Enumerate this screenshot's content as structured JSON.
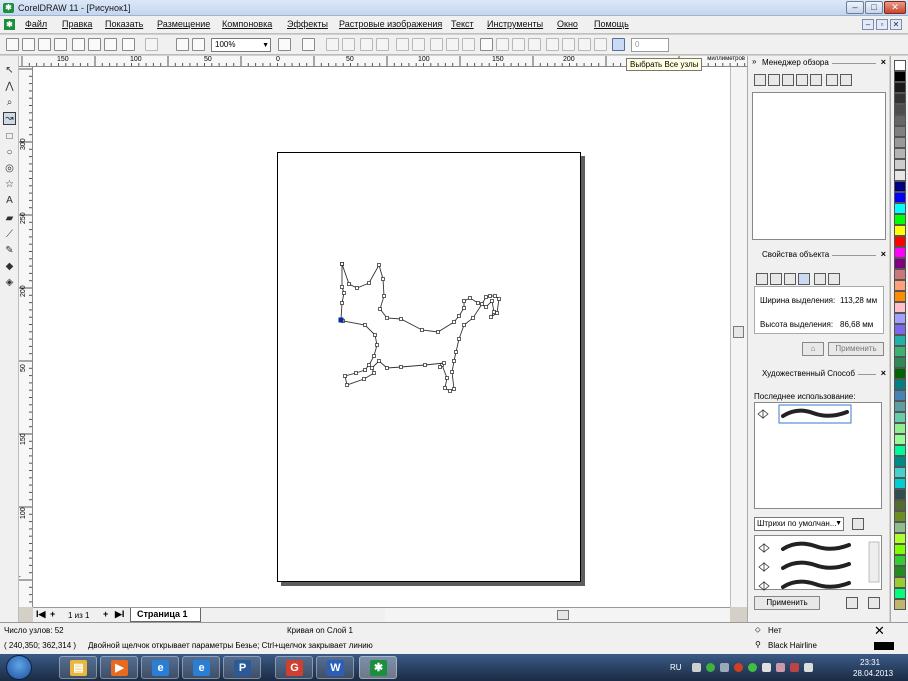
{
  "window": {
    "title": "CorelDRAW 11 - [Рисунок1]",
    "controls": {
      "minimize": "–",
      "maximize": "□",
      "close": "✕"
    }
  },
  "menu": {
    "items": [
      "Файл",
      "Правка",
      "Показать",
      "Размещение",
      "Компоновка",
      "Эффекты",
      "Растровые изображения",
      "Текст",
      "Инструменты",
      "Окно",
      "Помощь"
    ],
    "mdi": {
      "minimize": "–",
      "restore": "▫",
      "close": "✕"
    }
  },
  "toolbar": {
    "zoom_value": "100%",
    "nudge_value": "0",
    "tooltip": "Выбрать Все узлы"
  },
  "rulers": {
    "units": "миллиметров",
    "h_ticks": [
      "150",
      "100",
      "50",
      "0",
      "50",
      "100",
      "150",
      "200"
    ],
    "v_ticks": [
      "300",
      "250",
      "200",
      "150",
      "100",
      "50"
    ]
  },
  "page_nav": {
    "first": "I◀",
    "add_before": "+",
    "page_count": "1 из 1",
    "add_after": "+",
    "last": "▶I",
    "current_tab": "Страница 1"
  },
  "dockers": {
    "overview": {
      "title": "Менеджер обзора"
    },
    "properties": {
      "title": "Свойства объекта",
      "width_label": "Ширина выделения:",
      "width_value": "113,28 мм",
      "height_label": "Высота выделения:",
      "height_value": "86,68 мм",
      "apply_label": "Применить"
    },
    "artistic": {
      "title": "Художественный Способ",
      "last_used_label": "Последнее использование:",
      "preset_dropdown": "Штрихи по умолчан...",
      "apply_label": "Применить"
    }
  },
  "status": {
    "node_count": "Число узлов: 52",
    "object_info": "Кривая on Слой 1",
    "fill_label": "Нет",
    "outline_label": "Black  Hairline",
    "coords": "( 240,350; 362,314 )",
    "hint": "Двойной щелчок открывает параметры Безье; Ctrl+щелчок закрывает линию"
  },
  "taskbar": {
    "lang": "RU",
    "time": "23:31",
    "date": "28.04.2013"
  },
  "palette": [
    "#ffffff",
    "#000000",
    "#1a1a1a",
    "#333333",
    "#4d4d4d",
    "#666666",
    "#808080",
    "#999999",
    "#b3b3b3",
    "#cccccc",
    "#e6e6e6",
    "#000080",
    "#0000ff",
    "#00ffff",
    "#00ff00",
    "#ffff00",
    "#ff0000",
    "#ff00ff",
    "#800080",
    "#c87878",
    "#ffa07a",
    "#ff8c00",
    "#ffc0cb",
    "#a0a0ff",
    "#7b68ee",
    "#20b2aa",
    "#3cb371",
    "#2e8b57",
    "#006400",
    "#008080",
    "#4682b4",
    "#5f9ea0",
    "#66cdaa",
    "#90ee90",
    "#98fb98",
    "#00fa9a",
    "#008b8b",
    "#48d1cc",
    "#00ced1",
    "#2f4f4f",
    "#556b2f",
    "#6b8e23",
    "#8fbc8f",
    "#adff2f",
    "#7fff00",
    "#32cd32",
    "#228b22",
    "#9acd32",
    "#00ff7f",
    "#bdb76b"
  ]
}
